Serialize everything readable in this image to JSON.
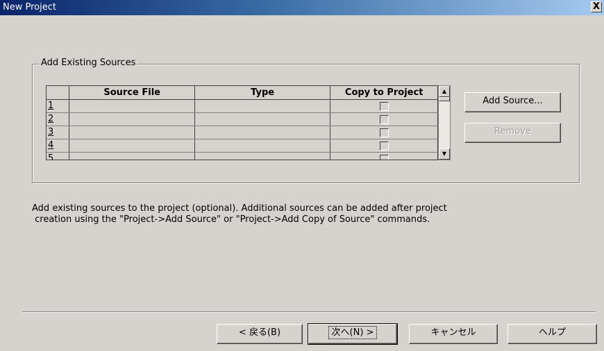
{
  "window": {
    "title": "New Project",
    "close_label": "X"
  },
  "group": {
    "legend": "Add Existing Sources"
  },
  "grid": {
    "columns": [
      "Source File",
      "Type",
      "Copy to Project"
    ],
    "rows": [
      {
        "num": "1",
        "source": "",
        "type": "",
        "copy": false
      },
      {
        "num": "2",
        "source": "",
        "type": "",
        "copy": false
      },
      {
        "num": "3",
        "source": "",
        "type": "",
        "copy": false
      },
      {
        "num": "4",
        "source": "",
        "type": "",
        "copy": false
      },
      {
        "num": "5",
        "source": "",
        "type": "",
        "copy": false
      }
    ]
  },
  "buttons": {
    "add_source": "Add Source...",
    "remove": "Remove",
    "back": "< 戻る(B)",
    "next": "次へ(N) >",
    "cancel": "キャンセル",
    "help": "ヘルプ"
  },
  "description": {
    "line1": "Add existing sources to the project (optional). Additional sources can be added after project",
    "line2": " creation using the \"Project->Add Source\" or \"Project->Add Copy of Source\" commands."
  }
}
